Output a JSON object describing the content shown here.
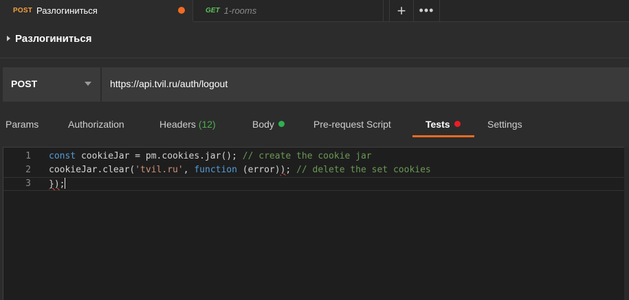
{
  "tabs": [
    {
      "method": "POST",
      "name": "Разлогиниться",
      "active": true,
      "unsaved": true
    },
    {
      "method": "GET",
      "name": "1-rooms",
      "active": false
    }
  ],
  "tab_actions": {
    "add_icon": "plus-icon",
    "add_glyph": "+",
    "more_icon": "more-icon",
    "more_glyph": "•••"
  },
  "request": {
    "title": "Разлогиниться",
    "method": "POST",
    "url": "https://api.tvil.ru/auth/logout"
  },
  "request_tabs": [
    {
      "label": "Params"
    },
    {
      "label": "Authorization"
    },
    {
      "label": "Headers",
      "count": "(12)"
    },
    {
      "label": "Body",
      "indicator": "green"
    },
    {
      "label": "Pre-request Script"
    },
    {
      "label": "Tests",
      "indicator": "red",
      "active": true
    },
    {
      "label": "Settings"
    }
  ],
  "editor": {
    "lines": [
      {
        "number": "1",
        "tokens": [
          {
            "t": "kw",
            "text": "const"
          },
          {
            "t": "pl",
            "text": " cookieJar = pm.cookies.jar(); "
          },
          {
            "t": "cm",
            "text": "// create the cookie jar"
          }
        ]
      },
      {
        "number": "2",
        "tokens": [
          {
            "t": "pl",
            "text": "cookieJar.clear("
          },
          {
            "t": "str",
            "text": "'tvil.ru'"
          },
          {
            "t": "pl",
            "text": ", "
          },
          {
            "t": "kw",
            "text": "function"
          },
          {
            "t": "pl",
            "text": " (error)"
          },
          {
            "t": "pl squig",
            "text": ")"
          },
          {
            "t": "pl",
            "text": "; "
          },
          {
            "t": "cm",
            "text": "// delete the set cookies"
          }
        ]
      },
      {
        "number": "3",
        "tokens": [
          {
            "t": "pl squig",
            "text": "})"
          },
          {
            "t": "pl",
            "text": ";"
          }
        ],
        "current": true
      }
    ]
  },
  "colors": {
    "accent": "#f26b21",
    "post": "#f7a13b",
    "get": "#5ec25e",
    "ok": "#2fb14f",
    "error": "#ee1c25"
  }
}
